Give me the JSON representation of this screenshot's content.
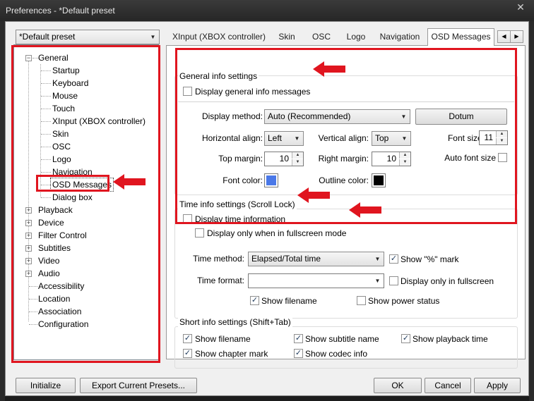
{
  "window": {
    "title": "Preferences - *Default preset"
  },
  "preset": {
    "value": "*Default preset"
  },
  "tree": {
    "items": [
      "General",
      "Startup",
      "Keyboard",
      "Mouse",
      "Touch",
      "XInput (XBOX controller)",
      "Skin",
      "OSC",
      "Logo",
      "Navigation",
      "OSD Messages",
      "Dialog box",
      "Playback",
      "Device",
      "Filter Control",
      "Subtitles",
      "Video",
      "Audio",
      "Accessibility",
      "Location",
      "Association",
      "Configuration"
    ]
  },
  "tabs": [
    "XInput (XBOX controller)",
    "Skin",
    "OSC",
    "Logo",
    "Navigation",
    "OSD Messages"
  ],
  "general": {
    "title": "General info settings",
    "display_msgs": "Display general info messages",
    "display_method_label": "Display method:",
    "display_method_value": "Auto (Recommended)",
    "dotum_btn": "Dotum",
    "h_align_label": "Horizontal align:",
    "h_align_value": "Left",
    "v_align_label": "Vertical align:",
    "v_align_value": "Top",
    "font_size_label": "Font size:",
    "font_size_value": "11",
    "top_margin_label": "Top margin:",
    "top_margin_value": "10",
    "right_margin_label": "Right margin:",
    "right_margin_value": "10",
    "auto_font_label": "Auto font size",
    "font_color_label": "Font color:",
    "font_color": "#4a78e8",
    "outline_color_label": "Outline color:",
    "outline_color": "#000000"
  },
  "time": {
    "title": "Time info settings (Scroll Lock)",
    "display_time": "Display time information",
    "fullscreen_only": "Display only when in fullscreen mode",
    "method_label": "Time method:",
    "method_value": "Elapsed/Total time",
    "show_pct": "Show \"%\" mark",
    "format_label": "Time format:",
    "format_value": "",
    "display_fullscreen": "Display only in fullscreen",
    "show_filename": "Show filename",
    "show_power": "Show power status"
  },
  "short": {
    "title": "Short info settings (Shift+Tab)",
    "show_filename": "Show filename",
    "show_subtitle": "Show subtitle name",
    "show_playback": "Show playback time",
    "show_chapter": "Show chapter mark",
    "show_codec": "Show codec info"
  },
  "buttons": {
    "initialize": "Initialize",
    "export": "Export Current Presets...",
    "ok": "OK",
    "cancel": "Cancel",
    "apply": "Apply"
  },
  "colors": {
    "highlight": "#e0151f",
    "accent": "#4a78e8"
  },
  "icons": {
    "close": "close-icon",
    "arrow": "red-arrow-icon",
    "check": "checkmark-icon"
  }
}
